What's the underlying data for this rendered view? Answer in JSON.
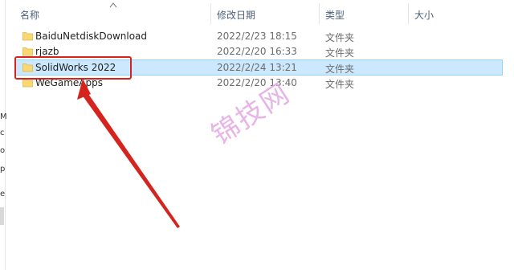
{
  "columns": {
    "name": "名称",
    "modified": "修改日期",
    "type": "类型",
    "size": "大小"
  },
  "rows": [
    {
      "name": "BaiduNetdiskDownload",
      "modified": "2022/2/23 18:15",
      "type": "文件夹",
      "selected": false
    },
    {
      "name": "rjazb",
      "modified": "2022/2/20 16:33",
      "type": "文件夹",
      "selected": false
    },
    {
      "name": "SolidWorks 2022",
      "modified": "2022/2/24 13:21",
      "type": "文件夹",
      "selected": true
    },
    {
      "name": "WeGameApps",
      "modified": "2022/2/20 13:40",
      "type": "文件夹",
      "selected": false
    }
  ],
  "watermark": "锦技网",
  "left_strip_chars": [
    "M",
    "c",
    "o",
    "p",
    "e"
  ],
  "colors": {
    "selection": "#cce8ff",
    "selection_border": "#99d1ff",
    "annotation_red": "#d5231d",
    "watermark": "#e3a7e3",
    "folder_yellow": "#f8d775"
  },
  "icons": {
    "folder": "folder-icon",
    "sort": "sort-up-chevron-icon",
    "annotation": "red-arrow-annotation"
  }
}
